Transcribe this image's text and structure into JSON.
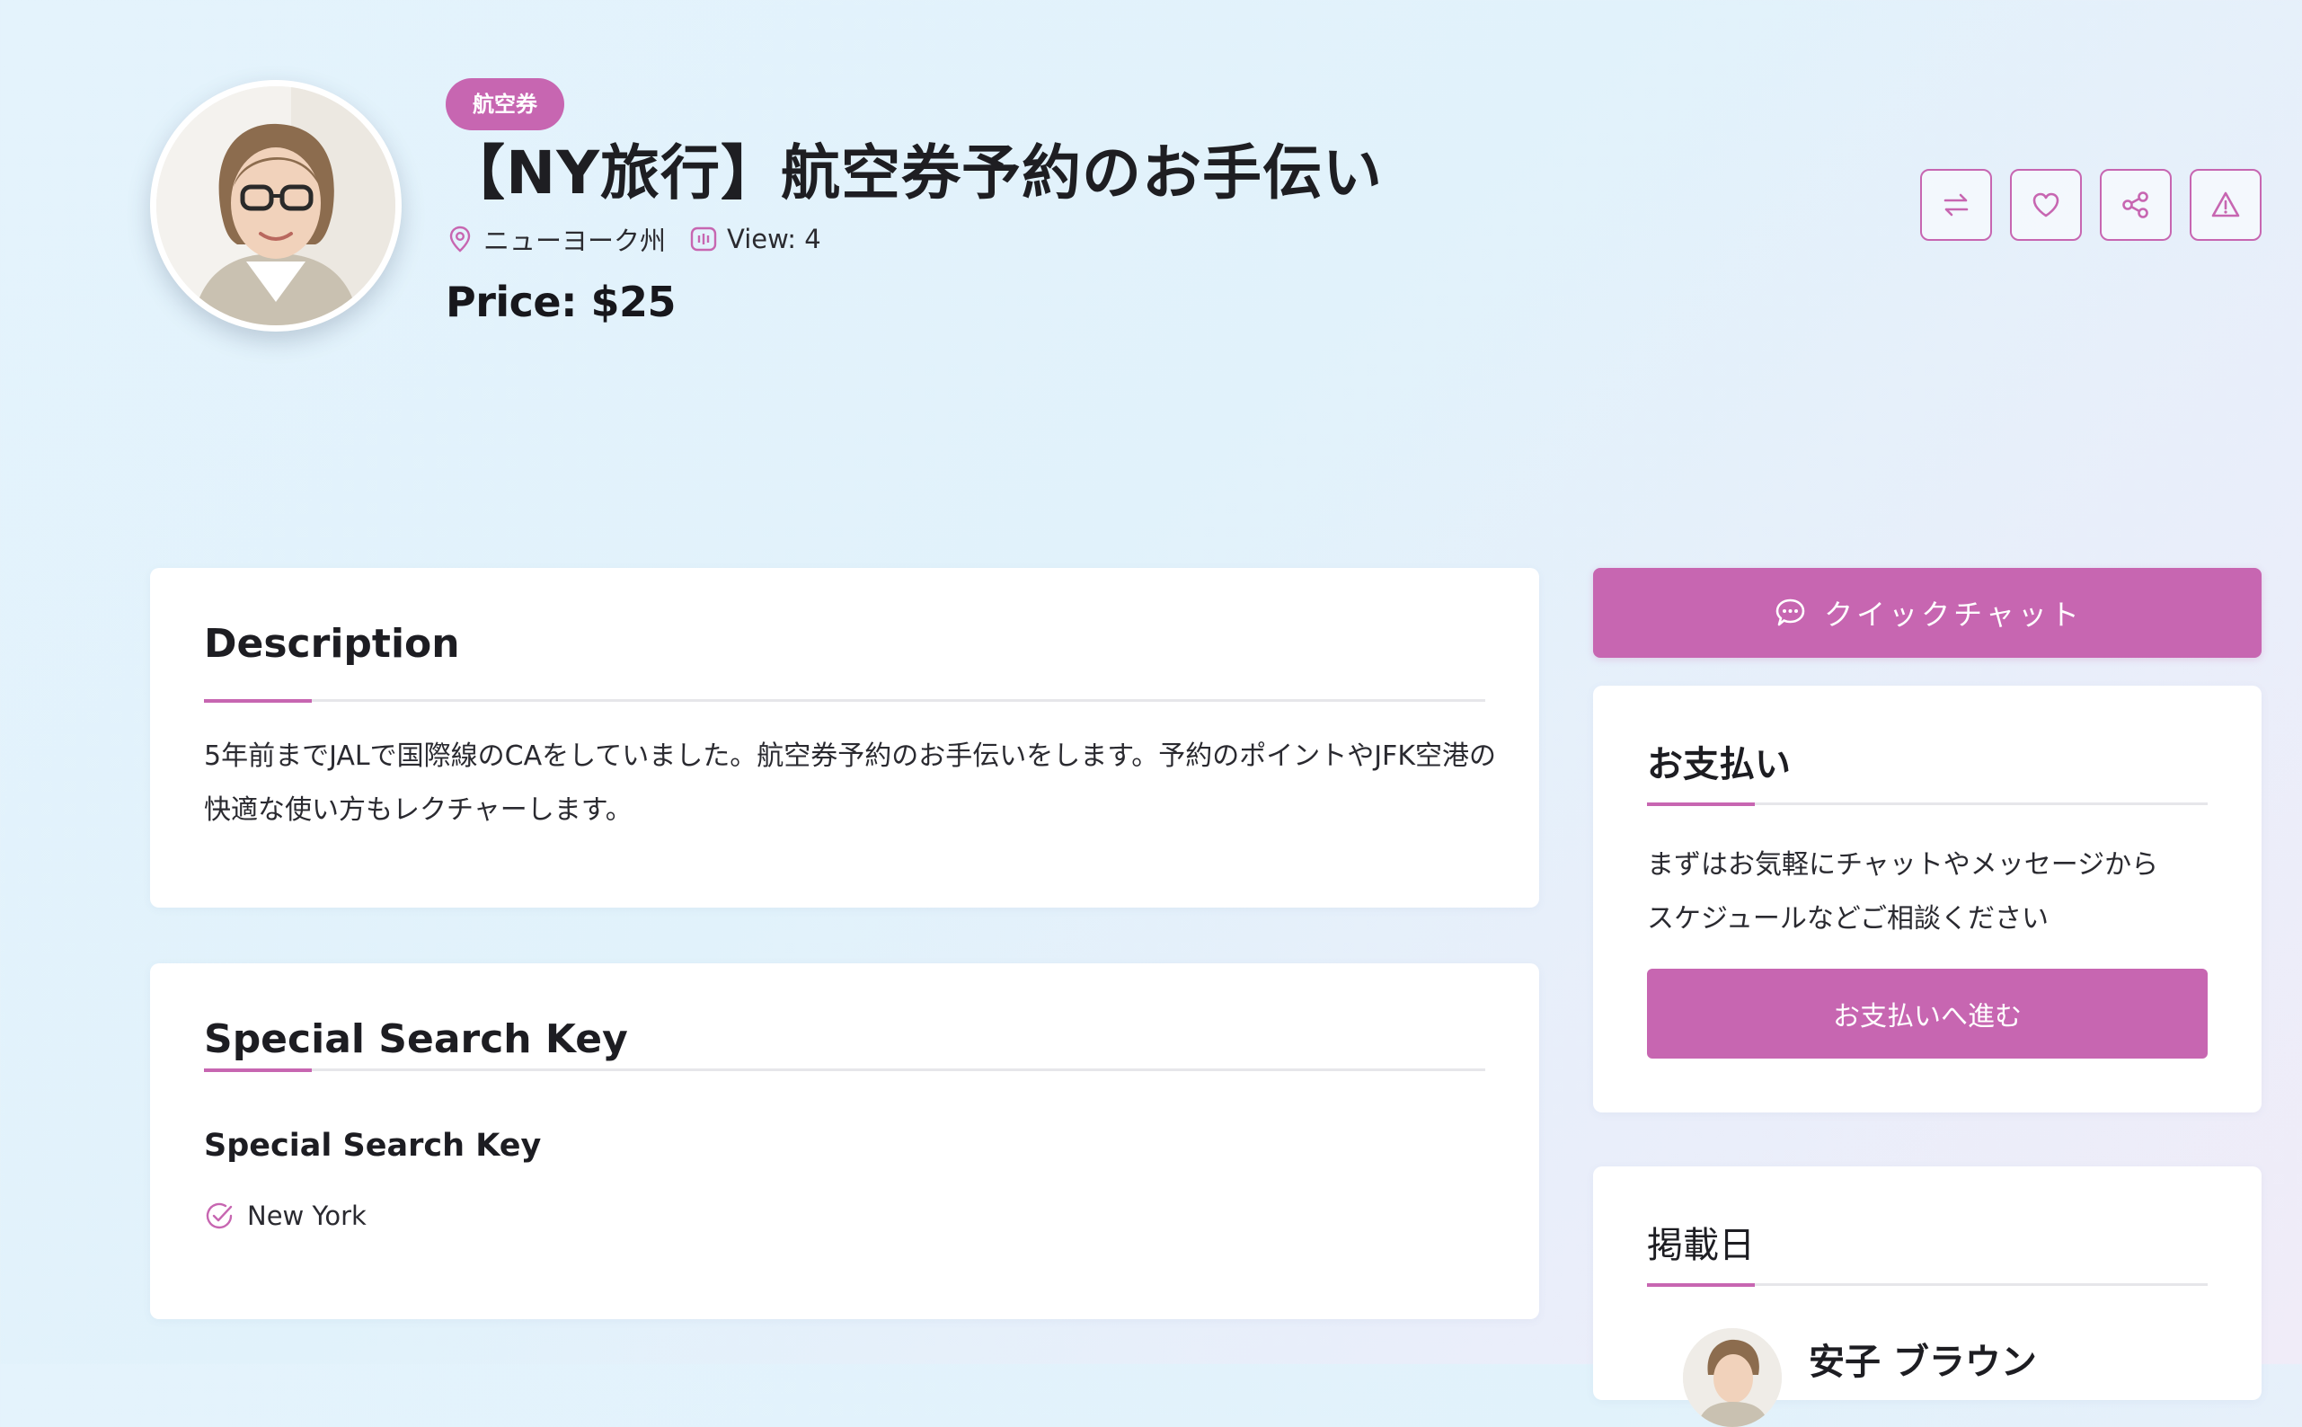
{
  "listing": {
    "category": "航空券",
    "title": "【NY旅行】航空券予約のお手伝い",
    "location": "ニューヨーク州",
    "views": "View: 4",
    "price": "Price: $25"
  },
  "actions": [
    {
      "name": "compare-button",
      "icon": "swap-arrows-icon"
    },
    {
      "name": "favorite-button",
      "icon": "heart-icon"
    },
    {
      "name": "share-button",
      "icon": "share-icon"
    },
    {
      "name": "report-button",
      "icon": "warning-triangle-icon"
    }
  ],
  "description": {
    "title": "Description",
    "text": "5年前までJALで国際線のCAをしていました。航空券予約のお手伝いをします。予約のポイントやJFK空港の快適な使い方もレクチャーします。"
  },
  "special_search": {
    "title": "Special Search Key",
    "subtitle": "Special Search Key",
    "items": [
      "New York"
    ]
  },
  "sidebar": {
    "chat_button": "クイックチャット",
    "payment": {
      "title": "お支払い",
      "text_line1": "まずはお気軽にチャットやメッセージから",
      "text_line2": "スケジュールなどご相談ください",
      "button": "お支払いへ進む"
    },
    "posted": {
      "title": "掲載日",
      "poster_name": "安子 ブラウン"
    }
  },
  "colors": {
    "accent": "#c766b1",
    "background": "#e3f3fb",
    "card": "#ffffff"
  }
}
